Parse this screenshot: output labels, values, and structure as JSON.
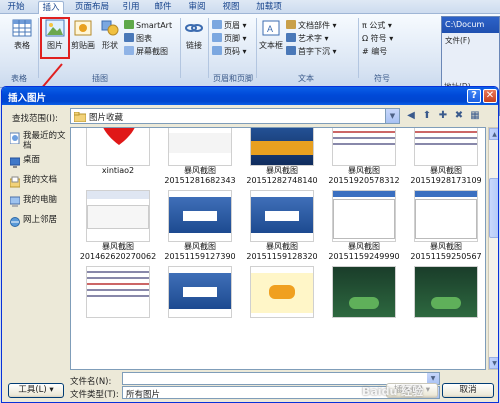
{
  "ribbon": {
    "tabs": [
      "开始",
      "插入",
      "页面布局",
      "引用",
      "邮件",
      "审阅",
      "视图",
      "加载项"
    ],
    "buttons": {
      "table": "表格",
      "picture": "图片",
      "clipart": "剪贴画",
      "shapes": "形状",
      "smartart": "SmartArt",
      "chart": "图表",
      "screenshot": "屏幕截图",
      "link": "链接",
      "header": "页眉",
      "footer": "页脚",
      "page_number": "页码",
      "textbox": "文本框",
      "quickparts": "文档部件",
      "wordart": "艺术字",
      "dropcap": "首字下沉",
      "equation": "公式",
      "symbol": "符号",
      "numbering": "编号"
    },
    "groups": [
      "表格",
      "插图",
      "页眉和页脚",
      "文本",
      "符号"
    ]
  },
  "background_window": {
    "title": "C:\\Docum",
    "menu": "文件(F)",
    "address": "地址(D)"
  },
  "dialog": {
    "title": "插入图片",
    "look_in_label": "查找范围(I):",
    "look_in_value": "图片收藏",
    "places": [
      "我最近的文档",
      "桌面",
      "我的文档",
      "我的电脑",
      "网上邻居"
    ],
    "files": [
      {
        "name": "xintiao2",
        "caption2": "",
        "kind": "heart"
      },
      {
        "name": "暴风截图",
        "caption2": "20151281682343",
        "kind": "ad"
      },
      {
        "name": "暴风截图",
        "caption2": "20151282748140",
        "kind": "poster"
      },
      {
        "name": "暴风截图",
        "caption2": "20151920578312",
        "kind": "doc"
      },
      {
        "name": "暴风截图",
        "caption2": "20151928173109",
        "kind": "doc"
      },
      {
        "name": "暴风截图",
        "caption2": "201462620270062",
        "kind": "web"
      },
      {
        "name": "暴风截图",
        "caption2": "20151159127390",
        "kind": "blue"
      },
      {
        "name": "暴风截图",
        "caption2": "20151159128320",
        "kind": "blue"
      },
      {
        "name": "暴风截图",
        "caption2": "20151159249990",
        "kind": "app"
      },
      {
        "name": "暴风截图",
        "caption2": "20151159250567",
        "kind": "app"
      },
      {
        "name": "",
        "caption2": "",
        "kind": "doc"
      },
      {
        "name": "",
        "caption2": "",
        "kind": "blue"
      },
      {
        "name": "",
        "caption2": "",
        "kind": "tianyi"
      },
      {
        "name": "",
        "caption2": "",
        "kind": "lotus"
      },
      {
        "name": "",
        "caption2": "",
        "kind": "lotus"
      }
    ],
    "file_name_label": "文件名(N):",
    "file_name_value": "",
    "file_type_label": "文件类型(T):",
    "file_type_value": "所有图片",
    "tools_label": "工具(L)",
    "insert_label": "插入(S)",
    "cancel_label": "取消"
  },
  "watermark": "Baidu 经验",
  "colors": {
    "title_blue": "#0049d8",
    "highlight_red": "#e02020",
    "ribbon_text": "#15428b"
  }
}
